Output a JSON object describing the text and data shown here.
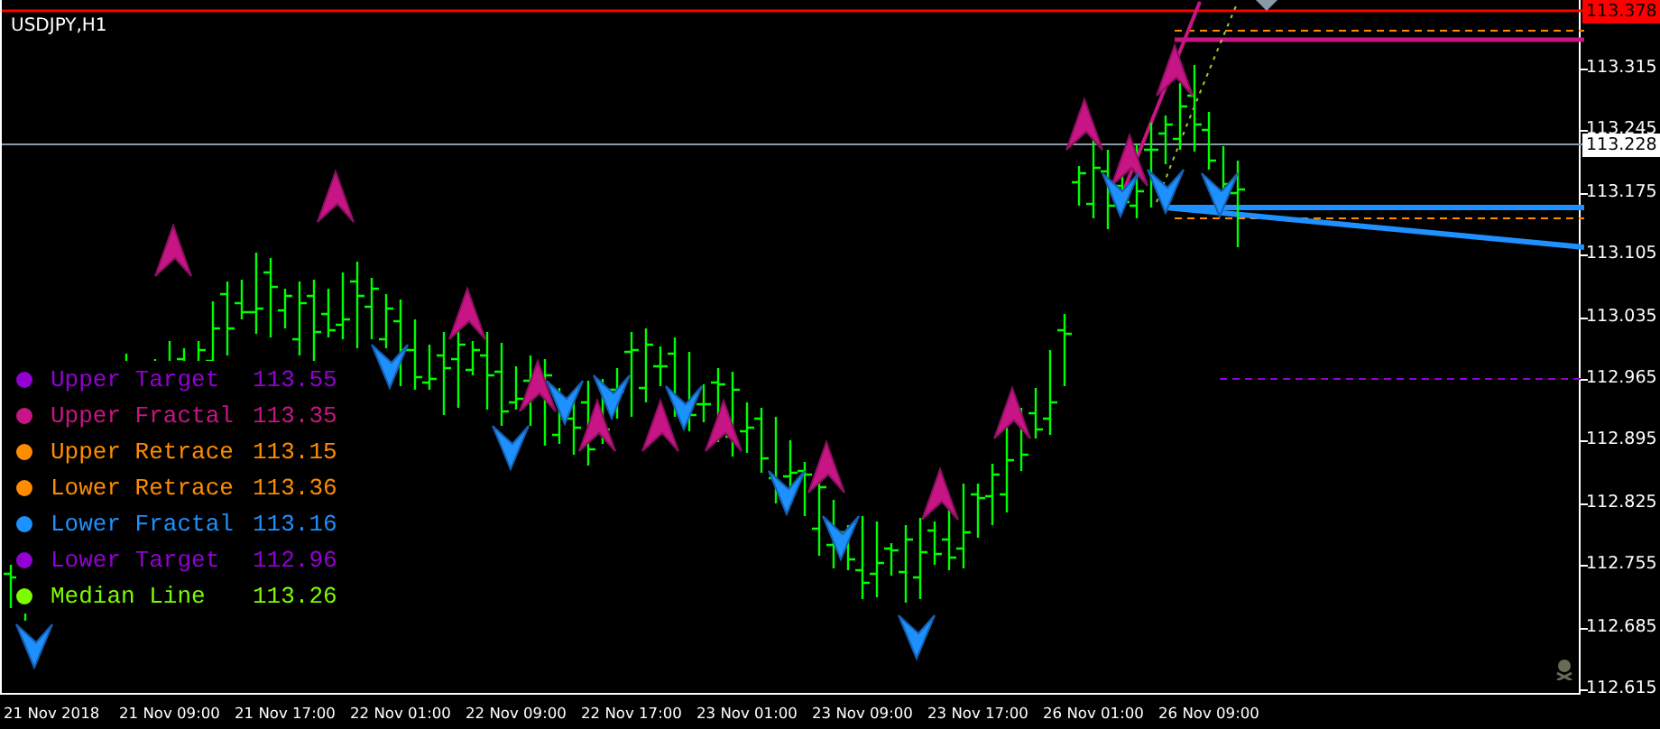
{
  "chart": {
    "title": "USDJPY,H1"
  },
  "legend": [
    {
      "label": "Upper Target",
      "value": "113.55",
      "color": "#9400d3"
    },
    {
      "label": "Upper Fractal",
      "value": "113.35",
      "color": "#c71585"
    },
    {
      "label": "Upper Retrace",
      "value": "113.15",
      "color": "#ff8c00"
    },
    {
      "label": "Lower Retrace",
      "value": "113.36",
      "color": "#ff8c00"
    },
    {
      "label": "Lower Fractal",
      "value": "113.16",
      "color": "#1e90ff"
    },
    {
      "label": "Lower Target",
      "value": "112.96",
      "color": "#9400d3"
    },
    {
      "label": "Median Line",
      "value": "113.26",
      "color": "#7cfc00"
    }
  ],
  "price_axis": {
    "ticks": [
      "113.315",
      "113.245",
      "113.175",
      "113.105",
      "113.035",
      "112.965",
      "112.895",
      "112.825",
      "112.755",
      "112.685",
      "112.615"
    ],
    "tags": [
      {
        "kind": "alert",
        "value": "113.378"
      },
      {
        "kind": "bid",
        "value": "113.228"
      }
    ]
  },
  "time_axis": [
    "21 Nov 2018",
    "21 Nov 09:00",
    "21 Nov 17:00",
    "22 Nov 01:00",
    "22 Nov 09:00",
    "22 Nov 17:00",
    "23 Nov 01:00",
    "23 Nov 09:00",
    "23 Nov 17:00",
    "26 Nov 01:00",
    "26 Nov 09:00"
  ]
}
